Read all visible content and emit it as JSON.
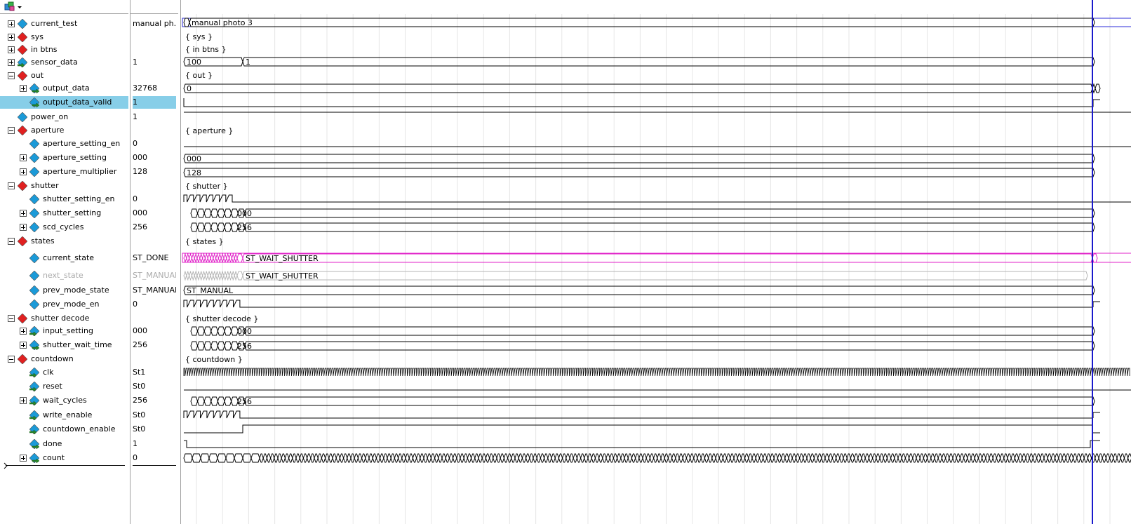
{
  "toolbar": {
    "icon": "signal-group-icon",
    "dropdown_icon": "chevron-down-icon"
  },
  "colors": {
    "cursor": "#1a1acc",
    "selection": "#87cee8",
    "diamond_blue": "#1b9ad8",
    "diamond_red": "#e02020",
    "state_highlight": "#e020c8",
    "group_highlight": "#2b2bd8"
  },
  "signals": [
    {
      "name": "current_test",
      "value": "manual ph...",
      "level": 0,
      "expand": "plus",
      "icon": "blue-diamond-icon"
    },
    {
      "name": "sys",
      "value": "",
      "level": 0,
      "expand": "plus",
      "icon": "red-diamond-icon"
    },
    {
      "name": "in btns",
      "value": "",
      "level": 0,
      "expand": "plus",
      "icon": "red-diamond-icon"
    },
    {
      "name": "sensor_data",
      "value": "1",
      "level": 0,
      "expand": "plus",
      "icon": "input-diamond-icon"
    },
    {
      "name": "out",
      "value": "",
      "level": 0,
      "expand": "minus",
      "icon": "red-diamond-icon"
    },
    {
      "name": "output_data",
      "value": "32768",
      "level": 1,
      "expand": "plus",
      "icon": "output-diamond-icon"
    },
    {
      "name": "output_data_valid",
      "value": "1",
      "level": 1,
      "expand": "none",
      "icon": "output-diamond-icon",
      "selected": true
    },
    {
      "name": "power_on",
      "value": "1",
      "level": 0,
      "expand": "none",
      "icon": "blue-diamond-icon"
    },
    {
      "name": "aperture",
      "value": "",
      "level": 0,
      "expand": "minus",
      "icon": "red-diamond-icon"
    },
    {
      "name": "aperture_setting_en",
      "value": "0",
      "level": 1,
      "expand": "none",
      "icon": "blue-diamond-icon"
    },
    {
      "name": "aperture_setting",
      "value": "000",
      "level": 1,
      "expand": "plus",
      "icon": "blue-diamond-icon"
    },
    {
      "name": "aperture_multiplier",
      "value": "128",
      "level": 1,
      "expand": "plus",
      "icon": "blue-diamond-icon"
    },
    {
      "name": "shutter",
      "value": "",
      "level": 0,
      "expand": "minus",
      "icon": "red-diamond-icon"
    },
    {
      "name": "shutter_setting_en",
      "value": "0",
      "level": 1,
      "expand": "none",
      "icon": "blue-diamond-icon"
    },
    {
      "name": "shutter_setting",
      "value": "000",
      "level": 1,
      "expand": "plus",
      "icon": "blue-diamond-icon"
    },
    {
      "name": "scd_cycles",
      "value": "256",
      "level": 1,
      "expand": "plus",
      "icon": "blue-diamond-icon"
    },
    {
      "name": "states",
      "value": "",
      "level": 0,
      "expand": "minus",
      "icon": "red-diamond-icon"
    },
    {
      "name": "current_state",
      "value": "ST_DONE",
      "level": 1,
      "expand": "none",
      "icon": "blue-diamond-icon"
    },
    {
      "name": "next_state",
      "value": "ST_MANUAL",
      "level": 1,
      "expand": "none",
      "icon": "blue-diamond-icon",
      "disabled": true
    },
    {
      "name": "prev_mode_state",
      "value": "ST_MANUAL",
      "level": 1,
      "expand": "none",
      "icon": "blue-diamond-icon"
    },
    {
      "name": "prev_mode_en",
      "value": "0",
      "level": 1,
      "expand": "none",
      "icon": "blue-diamond-icon"
    },
    {
      "name": "shutter decode",
      "value": "",
      "level": 0,
      "expand": "minus",
      "icon": "red-diamond-icon"
    },
    {
      "name": "input_setting",
      "value": "000",
      "level": 1,
      "expand": "plus",
      "icon": "input-diamond-icon"
    },
    {
      "name": "shutter_wait_time",
      "value": "256",
      "level": 1,
      "expand": "plus",
      "icon": "output-diamond-icon"
    },
    {
      "name": "countdown",
      "value": "",
      "level": 0,
      "expand": "minus",
      "icon": "red-diamond-icon"
    },
    {
      "name": "clk",
      "value": "St1",
      "level": 1,
      "expand": "none",
      "icon": "input-diamond-icon"
    },
    {
      "name": "reset",
      "value": "St0",
      "level": 1,
      "expand": "none",
      "icon": "input-diamond-icon"
    },
    {
      "name": "wait_cycles",
      "value": "256",
      "level": 1,
      "expand": "plus",
      "icon": "input-diamond-icon"
    },
    {
      "name": "write_enable",
      "value": "St0",
      "level": 1,
      "expand": "none",
      "icon": "input-diamond-icon"
    },
    {
      "name": "countdown_enable",
      "value": "St0",
      "level": 1,
      "expand": "none",
      "icon": "input-diamond-icon"
    },
    {
      "name": "done",
      "value": "1",
      "level": 1,
      "expand": "none",
      "icon": "output-diamond-icon"
    },
    {
      "name": "count",
      "value": "0",
      "level": 1,
      "expand": "plus",
      "icon": "output-diamond-icon"
    }
  ],
  "wave_labels": {
    "current_test": "manual photo 3",
    "sys": "{ sys }",
    "in_btns": "{ in btns }",
    "sensor_a": "100",
    "sensor_b": "1",
    "out": "{ out }",
    "output_data": "0",
    "aperture": "{ aperture }",
    "aperture_setting": "000",
    "aperture_multiplier": "128",
    "shutter": "{ shutter }",
    "shutter_setting": "000",
    "scd_cycles": "256",
    "states": "{ states }",
    "current_state": "ST_WAIT_SHUTTER",
    "next_state": "ST_WAIT_SHUTTER",
    "prev_mode_state": "ST_MANUAL",
    "shutter_decode": "{ shutter decode }",
    "input_setting": "000",
    "shutter_wait_time": "256",
    "countdown": "{ countdown }",
    "wait_cycles": "256"
  }
}
